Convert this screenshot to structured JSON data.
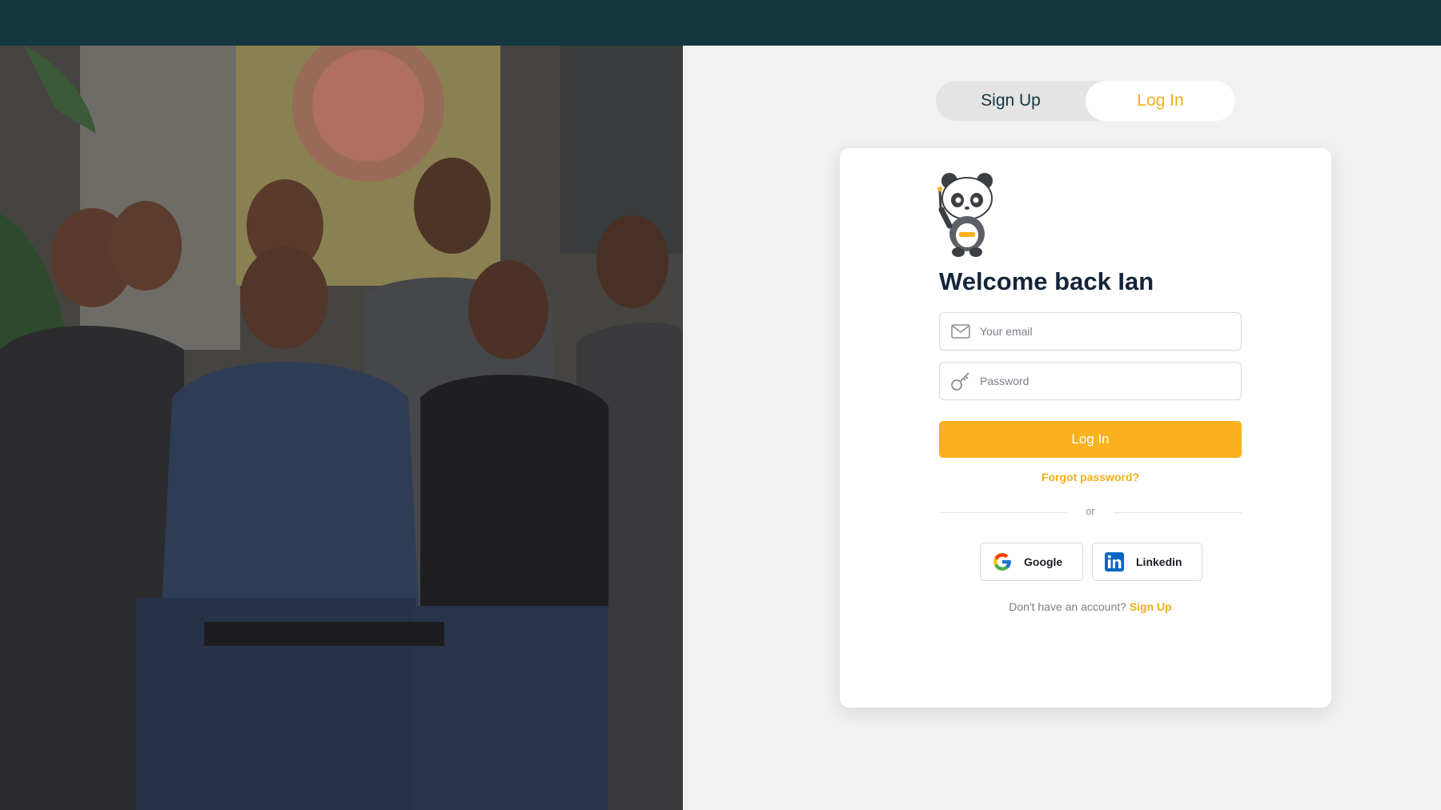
{
  "auth_toggle": {
    "signup_label": "Sign Up",
    "login_label": "Log In",
    "active": "login"
  },
  "login_card": {
    "welcome_title": "Welcome back Ian",
    "email_placeholder": "Your email",
    "password_placeholder": "Password",
    "login_button": "Log In",
    "forgot_password": "Forgot password?",
    "divider_text": "or",
    "social": [
      {
        "label": "Google",
        "icon": "google-icon"
      },
      {
        "label": "Linkedin",
        "icon": "linkedin-icon"
      }
    ],
    "no_account_text": "Don't have an account?",
    "signup_link": "Sign Up"
  },
  "colors": {
    "topbar": "#14363f",
    "accent": "#f9b21d",
    "link": "#f4ad1a",
    "background": "#f1f1f1"
  },
  "hero_image": {
    "icon": "team-photo"
  }
}
